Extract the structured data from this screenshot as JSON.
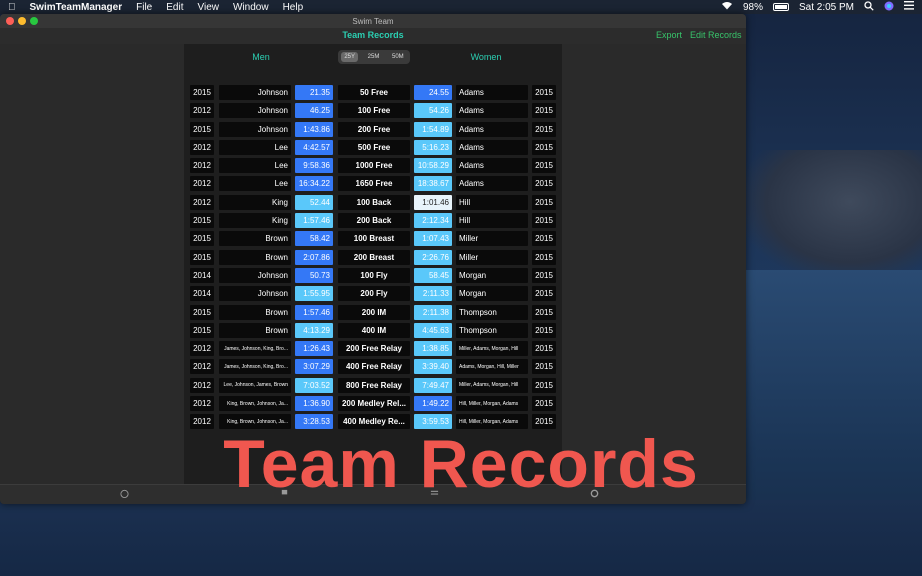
{
  "menubar": {
    "app_name": "SwimTeamManager",
    "items": [
      "File",
      "Edit",
      "View",
      "Window",
      "Help"
    ],
    "battery": "98%",
    "clock": "Sat 2:05 PM"
  },
  "window": {
    "title": "Swim Team",
    "toolbar_title": "Team Records",
    "export_label": "Export",
    "edit_label": "Edit Records"
  },
  "columns": {
    "men": "Men",
    "women": "Women"
  },
  "course_options": [
    {
      "label": "25Y",
      "selected": true
    },
    {
      "label": "25M",
      "selected": false
    },
    {
      "label": "50M",
      "selected": false
    }
  ],
  "records": [
    {
      "m_year": "2015",
      "m_name": "Johnson",
      "m_time": "21.35",
      "event": "50 Free",
      "w_time": "24.55",
      "w_name": "Adams",
      "w_year": "2015"
    },
    {
      "m_year": "2012",
      "m_name": "Johnson",
      "m_time": "46.25",
      "event": "100 Free",
      "w_time": "54.26",
      "w_name": "Adams",
      "w_year": "2015"
    },
    {
      "m_year": "2015",
      "m_name": "Johnson",
      "m_time": "1:43.86",
      "event": "200 Free",
      "w_time": "1:54.89",
      "w_name": "Adams",
      "w_year": "2015"
    },
    {
      "m_year": "2012",
      "m_name": "Lee",
      "m_time": "4:42.57",
      "event": "500 Free",
      "w_time": "5:16.23",
      "w_name": "Adams",
      "w_year": "2015"
    },
    {
      "m_year": "2012",
      "m_name": "Lee",
      "m_time": "9:58.36",
      "event": "1000 Free",
      "w_time": "10:58.29",
      "w_name": "Adams",
      "w_year": "2015"
    },
    {
      "m_year": "2012",
      "m_name": "Lee",
      "m_time": "16:34.22",
      "event": "1650 Free",
      "w_time": "18:38.67",
      "w_name": "Adams",
      "w_year": "2015"
    },
    {
      "m_year": "2012",
      "m_name": "King",
      "m_time": "52.44",
      "event": "100 Back",
      "w_time": "1:01.46",
      "w_name": "Hill",
      "w_year": "2015"
    },
    {
      "m_year": "2015",
      "m_name": "King",
      "m_time": "1:57.46",
      "event": "200 Back",
      "w_time": "2:12.34",
      "w_name": "Hill",
      "w_year": "2015"
    },
    {
      "m_year": "2015",
      "m_name": "Brown",
      "m_time": "58.42",
      "event": "100 Breast",
      "w_time": "1:07.43",
      "w_name": "Miller",
      "w_year": "2015"
    },
    {
      "m_year": "2015",
      "m_name": "Brown",
      "m_time": "2:07.86",
      "event": "200 Breast",
      "w_time": "2:26.76",
      "w_name": "Miller",
      "w_year": "2015"
    },
    {
      "m_year": "2014",
      "m_name": "Johnson",
      "m_time": "50.73",
      "event": "100 Fly",
      "w_time": "58.45",
      "w_name": "Morgan",
      "w_year": "2015"
    },
    {
      "m_year": "2014",
      "m_name": "Johnson",
      "m_time": "1:55.95",
      "event": "200 Fly",
      "w_time": "2:11.33",
      "w_name": "Morgan",
      "w_year": "2015"
    },
    {
      "m_year": "2015",
      "m_name": "Brown",
      "m_time": "1:57.46",
      "event": "200 IM",
      "w_time": "2:11.38",
      "w_name": "Thompson",
      "w_year": "2015"
    },
    {
      "m_year": "2015",
      "m_name": "Brown",
      "m_time": "4:13.29",
      "event": "400 IM",
      "w_time": "4:45.63",
      "w_name": "Thompson",
      "w_year": "2015"
    },
    {
      "m_year": "2012",
      "m_name": "James, Johnson, King, Bro...",
      "m_time": "1:26.43",
      "event": "200 Free Relay",
      "w_time": "1:38.85",
      "w_name": "Miller, Adams, Morgan, Hill",
      "w_year": "2015"
    },
    {
      "m_year": "2012",
      "m_name": "James, Johnson, King, Bro...",
      "m_time": "3:07.29",
      "event": "400 Free Relay",
      "w_time": "3:39.40",
      "w_name": "Adams, Morgan, Hill, Miller",
      "w_year": "2015"
    },
    {
      "m_year": "2012",
      "m_name": "Lee, Johnson, James, Brown",
      "m_time": "7:03.52",
      "event": "800 Free Relay",
      "w_time": "7:49.47",
      "w_name": "Miller, Adams, Morgan, Hill",
      "w_year": "2015"
    },
    {
      "m_year": "2012",
      "m_name": "King, Brown, Johnson, Ja...",
      "m_time": "1:36.90",
      "event": "200 Medley Rel...",
      "w_time": "1:49.22",
      "w_name": "Hill, Miller, Morgan, Adams",
      "w_year": "2015"
    },
    {
      "m_year": "2012",
      "m_name": "King, Brown, Johnson, Ja...",
      "m_time": "3:28.53",
      "event": "400 Medley Re...",
      "w_time": "3:59.53",
      "w_name": "Hill, Miller, Morgan, Adams",
      "w_year": "2015"
    }
  ],
  "overlay_title": "Team Records",
  "colors": {
    "accent": "#2bcfb2",
    "toolbar_button": "#38c46b",
    "time_blue": "#3478f6",
    "time_light": "#5ac8fa",
    "overlay": "#f0574f"
  }
}
